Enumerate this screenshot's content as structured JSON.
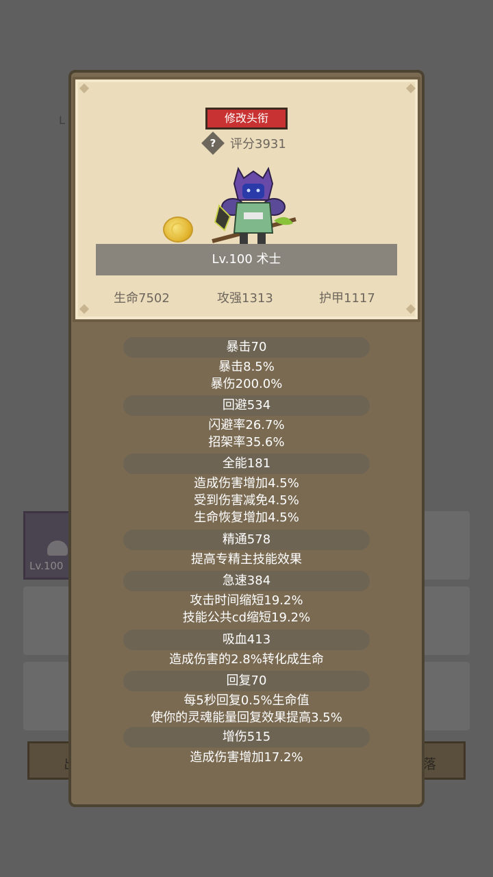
{
  "background": {
    "partial_label": "L",
    "item_card_level": "Lv.100",
    "left_button_glyph": "出",
    "right_button_glyph": "落"
  },
  "panel": {
    "rename_button": "修改头衔",
    "help_symbol": "?",
    "score_label": "评分3931",
    "class_banner": "Lv.100 术士",
    "stats": {
      "life": "生命7502",
      "attack": "攻强1313",
      "armor": "护甲1117"
    }
  },
  "attributes": [
    {
      "title": "暴击70",
      "lines": [
        "暴击8.5%",
        "暴伤200.0%"
      ]
    },
    {
      "title": "回避534",
      "lines": [
        "闪避率26.7%",
        "招架率35.6%"
      ]
    },
    {
      "title": "全能181",
      "lines": [
        "造成伤害增加4.5%",
        "受到伤害减免4.5%",
        "生命恢复增加4.5%"
      ]
    },
    {
      "title": "精通578",
      "lines": [
        "提高专精主技能效果"
      ]
    },
    {
      "title": "急速384",
      "lines": [
        "攻击时间缩短19.2%",
        "技能公共cd缩短19.2%"
      ]
    },
    {
      "title": "吸血413",
      "lines": [
        "造成伤害的2.8%转化成生命"
      ]
    },
    {
      "title": "回复70",
      "lines": [
        "每5秒回复0.5%生命值",
        "使你的灵魂能量回复效果提高3.5%"
      ]
    },
    {
      "title": "增伤515",
      "lines": [
        "造成伤害增加17.2%"
      ]
    }
  ],
  "colors": {
    "accent_button": "#c83232",
    "panel_bg": "#7a6a52",
    "card_bg": "#ebdcbc"
  },
  "icons": {
    "coin": "gold-coin-icon",
    "hero": "warlock-hero-sprite",
    "help": "help-diamond-icon"
  }
}
